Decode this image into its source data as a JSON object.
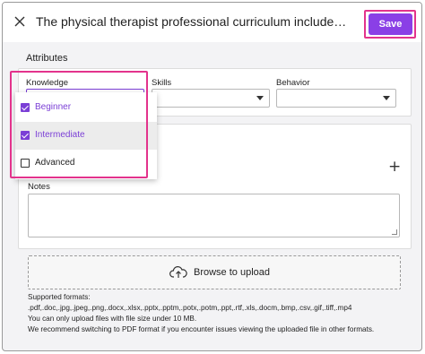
{
  "header": {
    "title": "The physical therapist professional curriculum includes content and le...",
    "save_label": "Save"
  },
  "attributes": {
    "section_title": "Attributes",
    "columns": [
      {
        "label": "Knowledge",
        "value": ""
      },
      {
        "label": "Skills",
        "value": ""
      },
      {
        "label": "Behavior",
        "value": ""
      }
    ],
    "knowledge_options": [
      {
        "label": "Beginner",
        "checked": true
      },
      {
        "label": "Intermediate",
        "checked": true
      },
      {
        "label": "Advanced",
        "checked": false
      }
    ]
  },
  "notes": {
    "label": "Notes",
    "value": ""
  },
  "upload": {
    "button_label": "Browse to upload",
    "formats_title": "Supported formats:",
    "formats": ".pdf,.doc,.jpg,.jpeg,.png,.docx,.xlsx,.pptx,.pptm,.potx,.potm,.ppt,.rtf,.xls,.docm,.bmp,.csv,.gif,.tiff,.mp4",
    "size_note": "You can only upload files with file size under 10 MB.",
    "pdf_note": "We recommend switching to PDF format if you encounter issues viewing the uploaded file in other formats."
  },
  "colors": {
    "accent": "#8a3fe6",
    "highlight": "#e3338c"
  }
}
